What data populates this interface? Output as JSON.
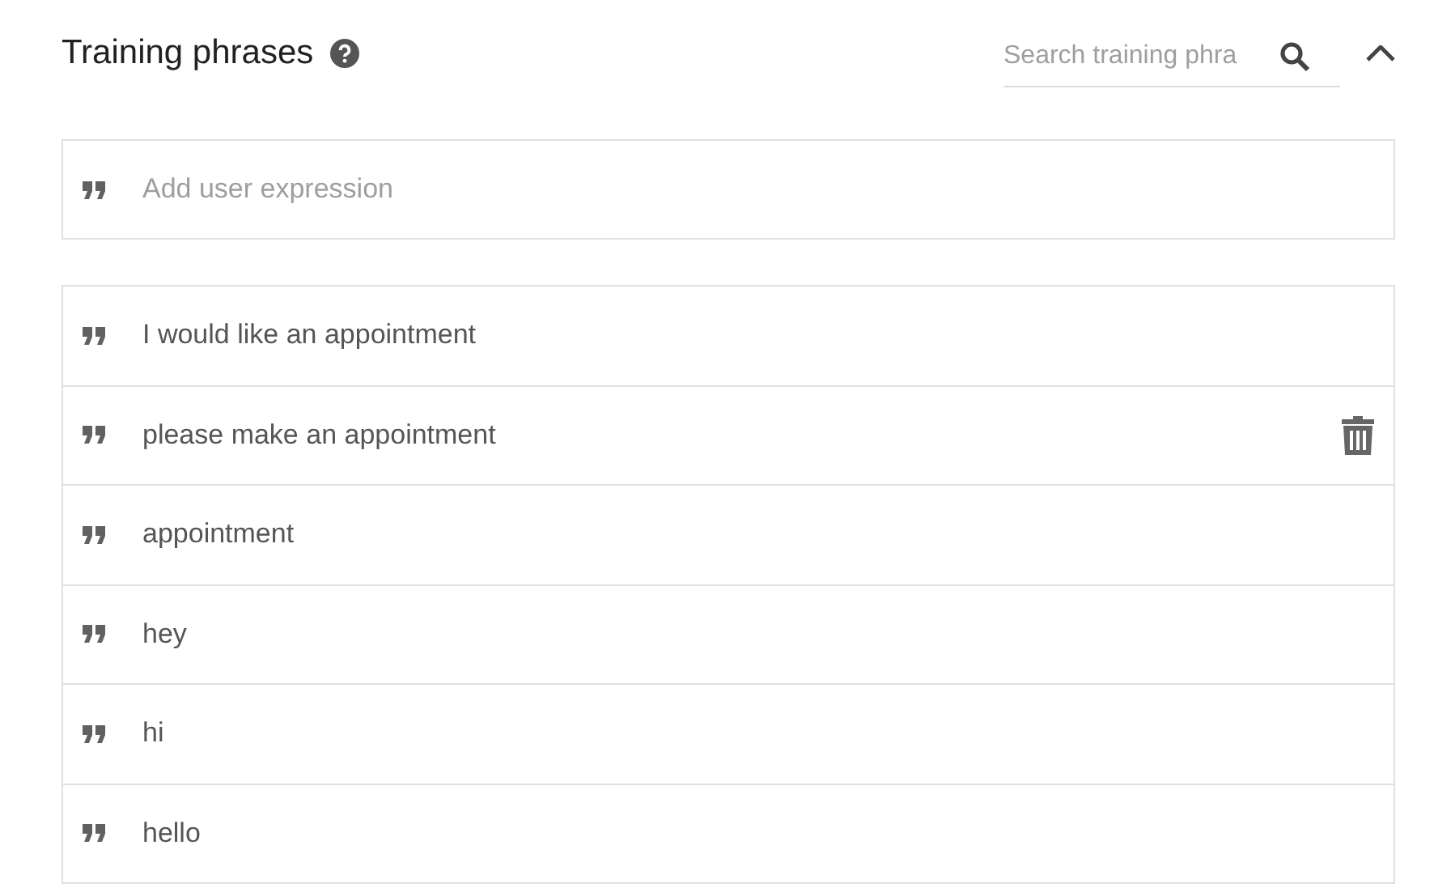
{
  "section": {
    "title": "Training phrases",
    "search": {
      "placeholder": "Search training phra"
    },
    "expanded": true
  },
  "add_field": {
    "placeholder": "Add user expression"
  },
  "phrases": [
    {
      "text": "I would like an appointment",
      "show_delete": false
    },
    {
      "text": "please make an appointment",
      "show_delete": true
    },
    {
      "text": "appointment",
      "show_delete": false
    },
    {
      "text": "hey",
      "show_delete": false
    },
    {
      "text": "hi",
      "show_delete": false
    },
    {
      "text": "hello",
      "show_delete": false
    }
  ]
}
